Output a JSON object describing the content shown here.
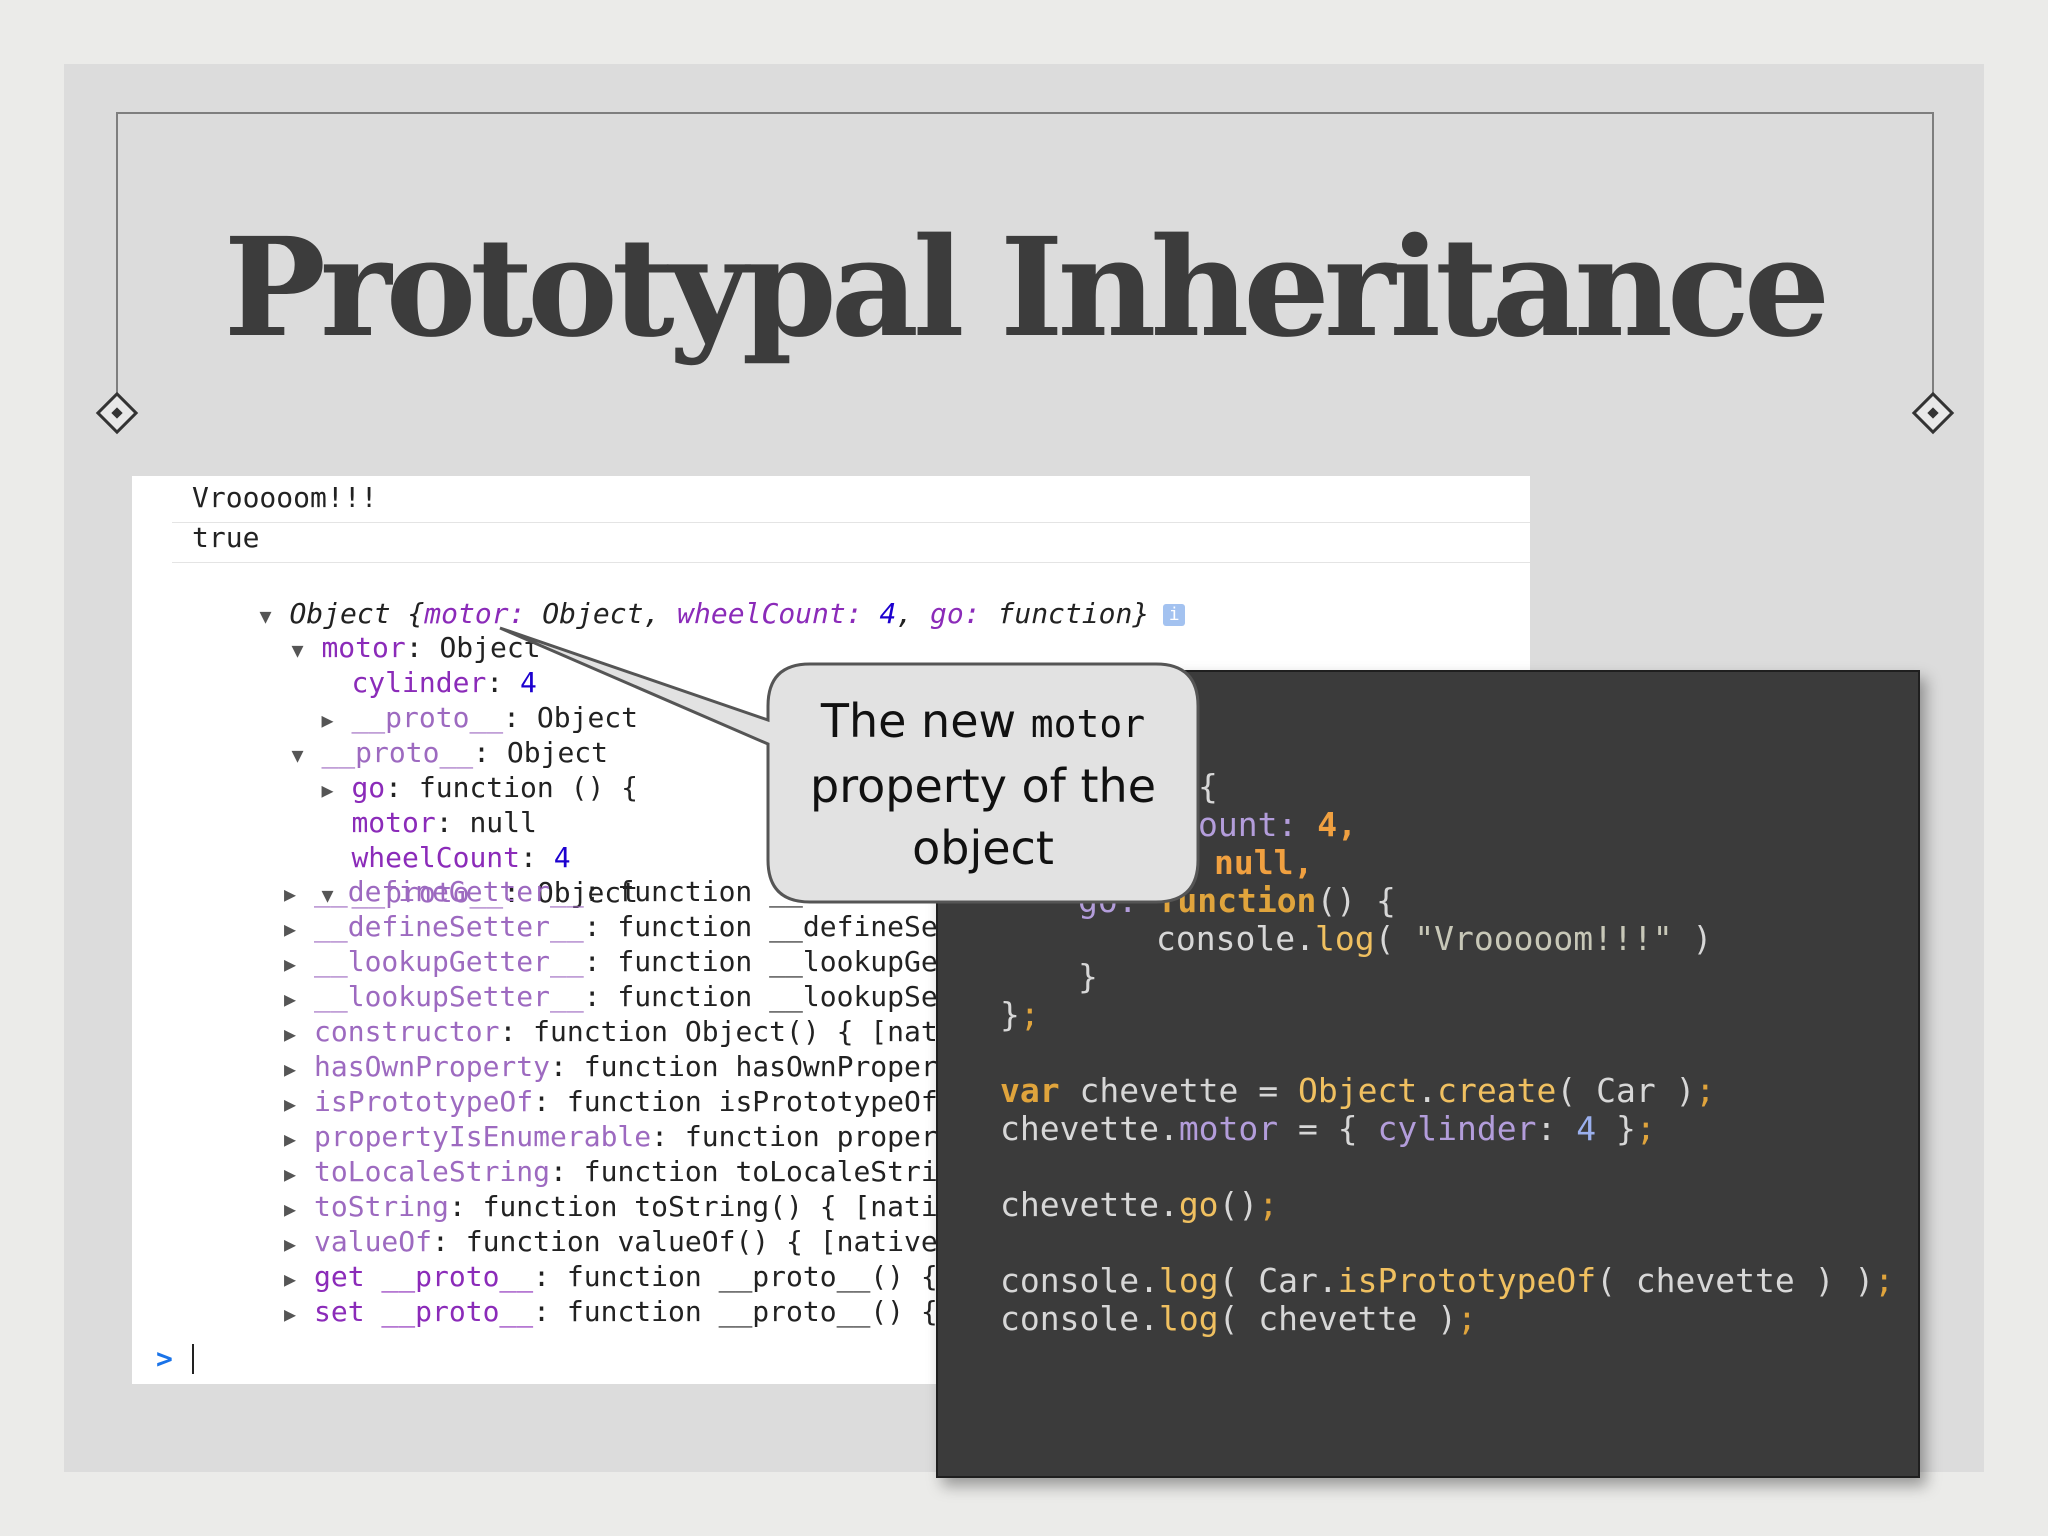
{
  "slide": {
    "title": "Prototypal Inheritance"
  },
  "console": {
    "lines": [
      "Vrooooom!!!",
      "true",
      "Object {",
      "motor:",
      " Object, ",
      "wheelCount:",
      " 4",
      ", ",
      "go:",
      " function}",
      "i",
      "motor",
      ": Object",
      "cylinder",
      ": ",
      "4",
      "__proto__",
      ": Object",
      "__proto__",
      ": Object",
      "go",
      ": function () {",
      "motor",
      ": null",
      "wheelCount",
      ": ",
      "4",
      "__proto__",
      ": Object",
      "__defineGetter__",
      ": function __d",
      "__defineSetter__",
      ": function __defineSett",
      "__lookupGetter__",
      ": function __lookupGett",
      "__lookupSetter__",
      ": function __lookupSett",
      "constructor",
      ": function Object() { [nativ",
      "hasOwnProperty",
      ": function hasOwnProperty",
      "isPrototypeOf",
      ": function isPrototypeOf()",
      "propertyIsEnumerable",
      ": function property",
      "toLocaleString",
      ": function toLocaleString",
      "toString",
      ": function toString() { [native",
      "valueOf",
      ": function valueOf() { [native c",
      "get __proto__",
      ": function __proto__() { [",
      "set __proto__",
      ": function __proto__() { ["
    ],
    "prompt_symbol": ">"
  },
  "callout": {
    "line1_prefix": "The new ",
    "line1_code": "motor",
    "line2": "property of the",
    "line3": "object"
  },
  "code": {
    "l1_a": "{",
    "l2_a": "ount: ",
    "l2_b": "4,",
    "l3_a": "null,",
    "l4_a": "go: ",
    "l4_b": "function",
    "l4_c": "() {",
    "l5_a": "console.",
    "l5_b": "log",
    "l5_c": "( ",
    "l5_d": "\"Vrooooom!!!\"",
    "l5_e": " )",
    "l6_a": "}",
    "l7_a": "}",
    "l7_b": ";",
    "l8_a": "var",
    "l8_b": " chevette = ",
    "l8_c": "Object",
    "l8_d": ".",
    "l8_e": "create",
    "l8_f": "( Car )",
    "l8_g": ";",
    "l9_a": "chevette.",
    "l9_b": "motor",
    "l9_c": " = { ",
    "l9_d": "cylinder",
    "l9_e": ": ",
    "l9_f": "4",
    "l9_g": " }",
    "l9_h": ";",
    "l10_a": "chevette.",
    "l10_b": "go",
    "l10_c": "()",
    "l10_d": ";",
    "l11_a": "console.",
    "l11_b": "log",
    "l11_c": "( Car.",
    "l11_d": "isPrototypeOf",
    "l11_e": "( chevette ) )",
    "l11_f": ";",
    "l12_a": "console.",
    "l12_b": "log",
    "l12_c": "( chevette )",
    "l12_d": ";"
  },
  "colors": {
    "slide_bg": "#dcdcdc",
    "code_bg": "#3b3b3b",
    "keyword": "#e0a43c",
    "console_property": "#8b2bb9",
    "console_number": "#1c00cf"
  },
  "icons": {
    "expanded": "triangle-down-icon",
    "collapsed": "triangle-right-icon",
    "info": "info-icon",
    "prompt": "prompt-chevron-icon",
    "frame_ornament": "diamond-ornament-icon"
  }
}
